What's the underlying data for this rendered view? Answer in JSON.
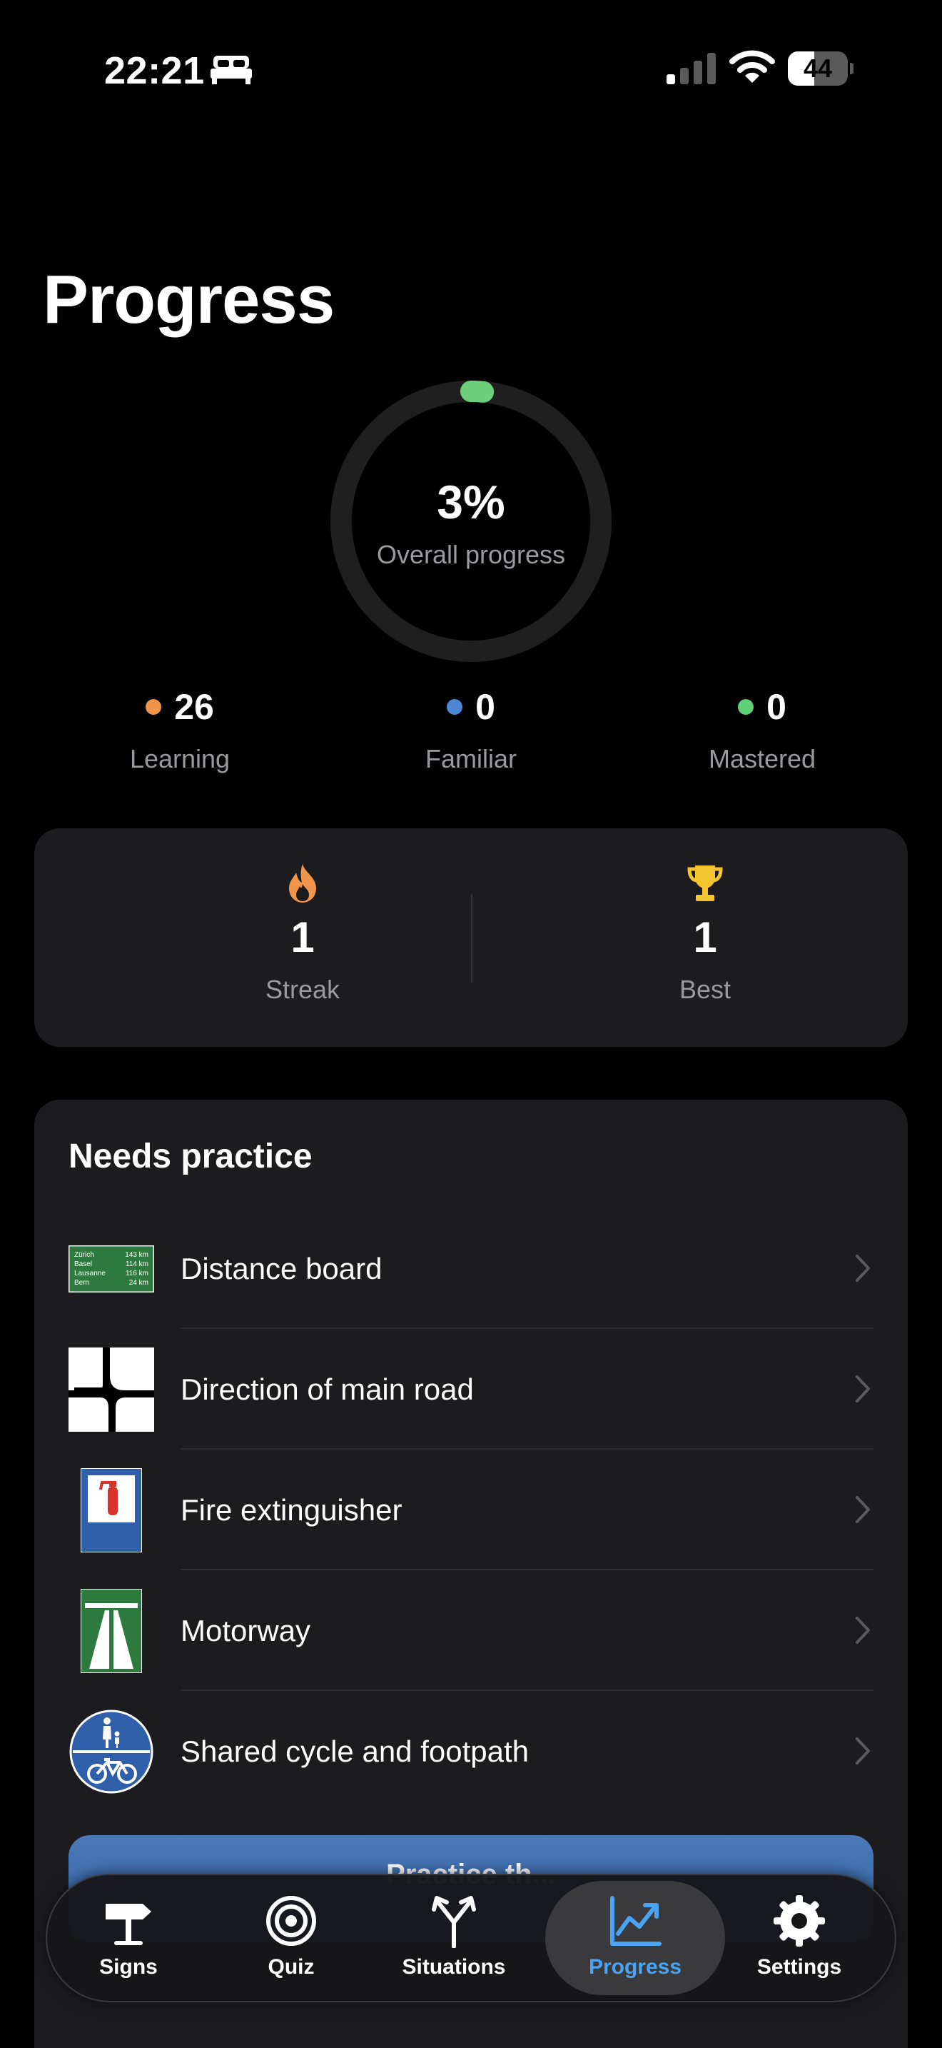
{
  "status_bar": {
    "time": "22:21",
    "battery_level": 44,
    "battery_text": "44"
  },
  "page": {
    "title": "Progress"
  },
  "overall": {
    "percent_text": "3%",
    "label": "Overall progress",
    "fraction": 0.03,
    "ring_color": "#6ecf7a",
    "track_color": "#1f1f1f"
  },
  "stats": [
    {
      "value": "26",
      "label": "Learning",
      "color": "#f0954a"
    },
    {
      "value": "0",
      "label": "Familiar",
      "color": "#4e86d6"
    },
    {
      "value": "0",
      "label": "Mastered",
      "color": "#5fcf78"
    }
  ],
  "streak": {
    "current": {
      "value": "1",
      "label": "Streak",
      "icon": "flame-icon"
    },
    "best": {
      "value": "1",
      "label": "Best",
      "icon": "trophy-icon"
    }
  },
  "needs_practice": {
    "title": "Needs practice",
    "items": [
      {
        "label": "Distance board",
        "icon": "distance-board-sign-icon",
        "sign_lines": [
          [
            "Zürich",
            "143 km"
          ],
          [
            "Basel",
            "114 km"
          ],
          [
            "Lausanne",
            "116 km"
          ],
          [
            "Bern",
            "24 km"
          ]
        ]
      },
      {
        "label": "Direction of main road",
        "icon": "main-road-direction-sign-icon"
      },
      {
        "label": "Fire extinguisher",
        "icon": "fire-extinguisher-sign-icon"
      },
      {
        "label": "Motorway",
        "icon": "motorway-sign-icon"
      },
      {
        "label": "Shared cycle and footpath",
        "icon": "shared-path-sign-icon"
      }
    ],
    "button_label": "Practice th..."
  },
  "tabs": [
    {
      "label": "Signs",
      "icon": "signpost-icon",
      "active": false
    },
    {
      "label": "Quiz",
      "icon": "target-icon",
      "active": false
    },
    {
      "label": "Situations",
      "icon": "fork-arrows-icon",
      "active": false
    },
    {
      "label": "Progress",
      "icon": "chart-line-icon",
      "active": true
    },
    {
      "label": "Settings",
      "icon": "gear-icon",
      "active": false
    }
  ],
  "colors": {
    "accent": "#4aa3f5",
    "card": "#1c1c1e",
    "muted_text": "#9a9a9e"
  }
}
